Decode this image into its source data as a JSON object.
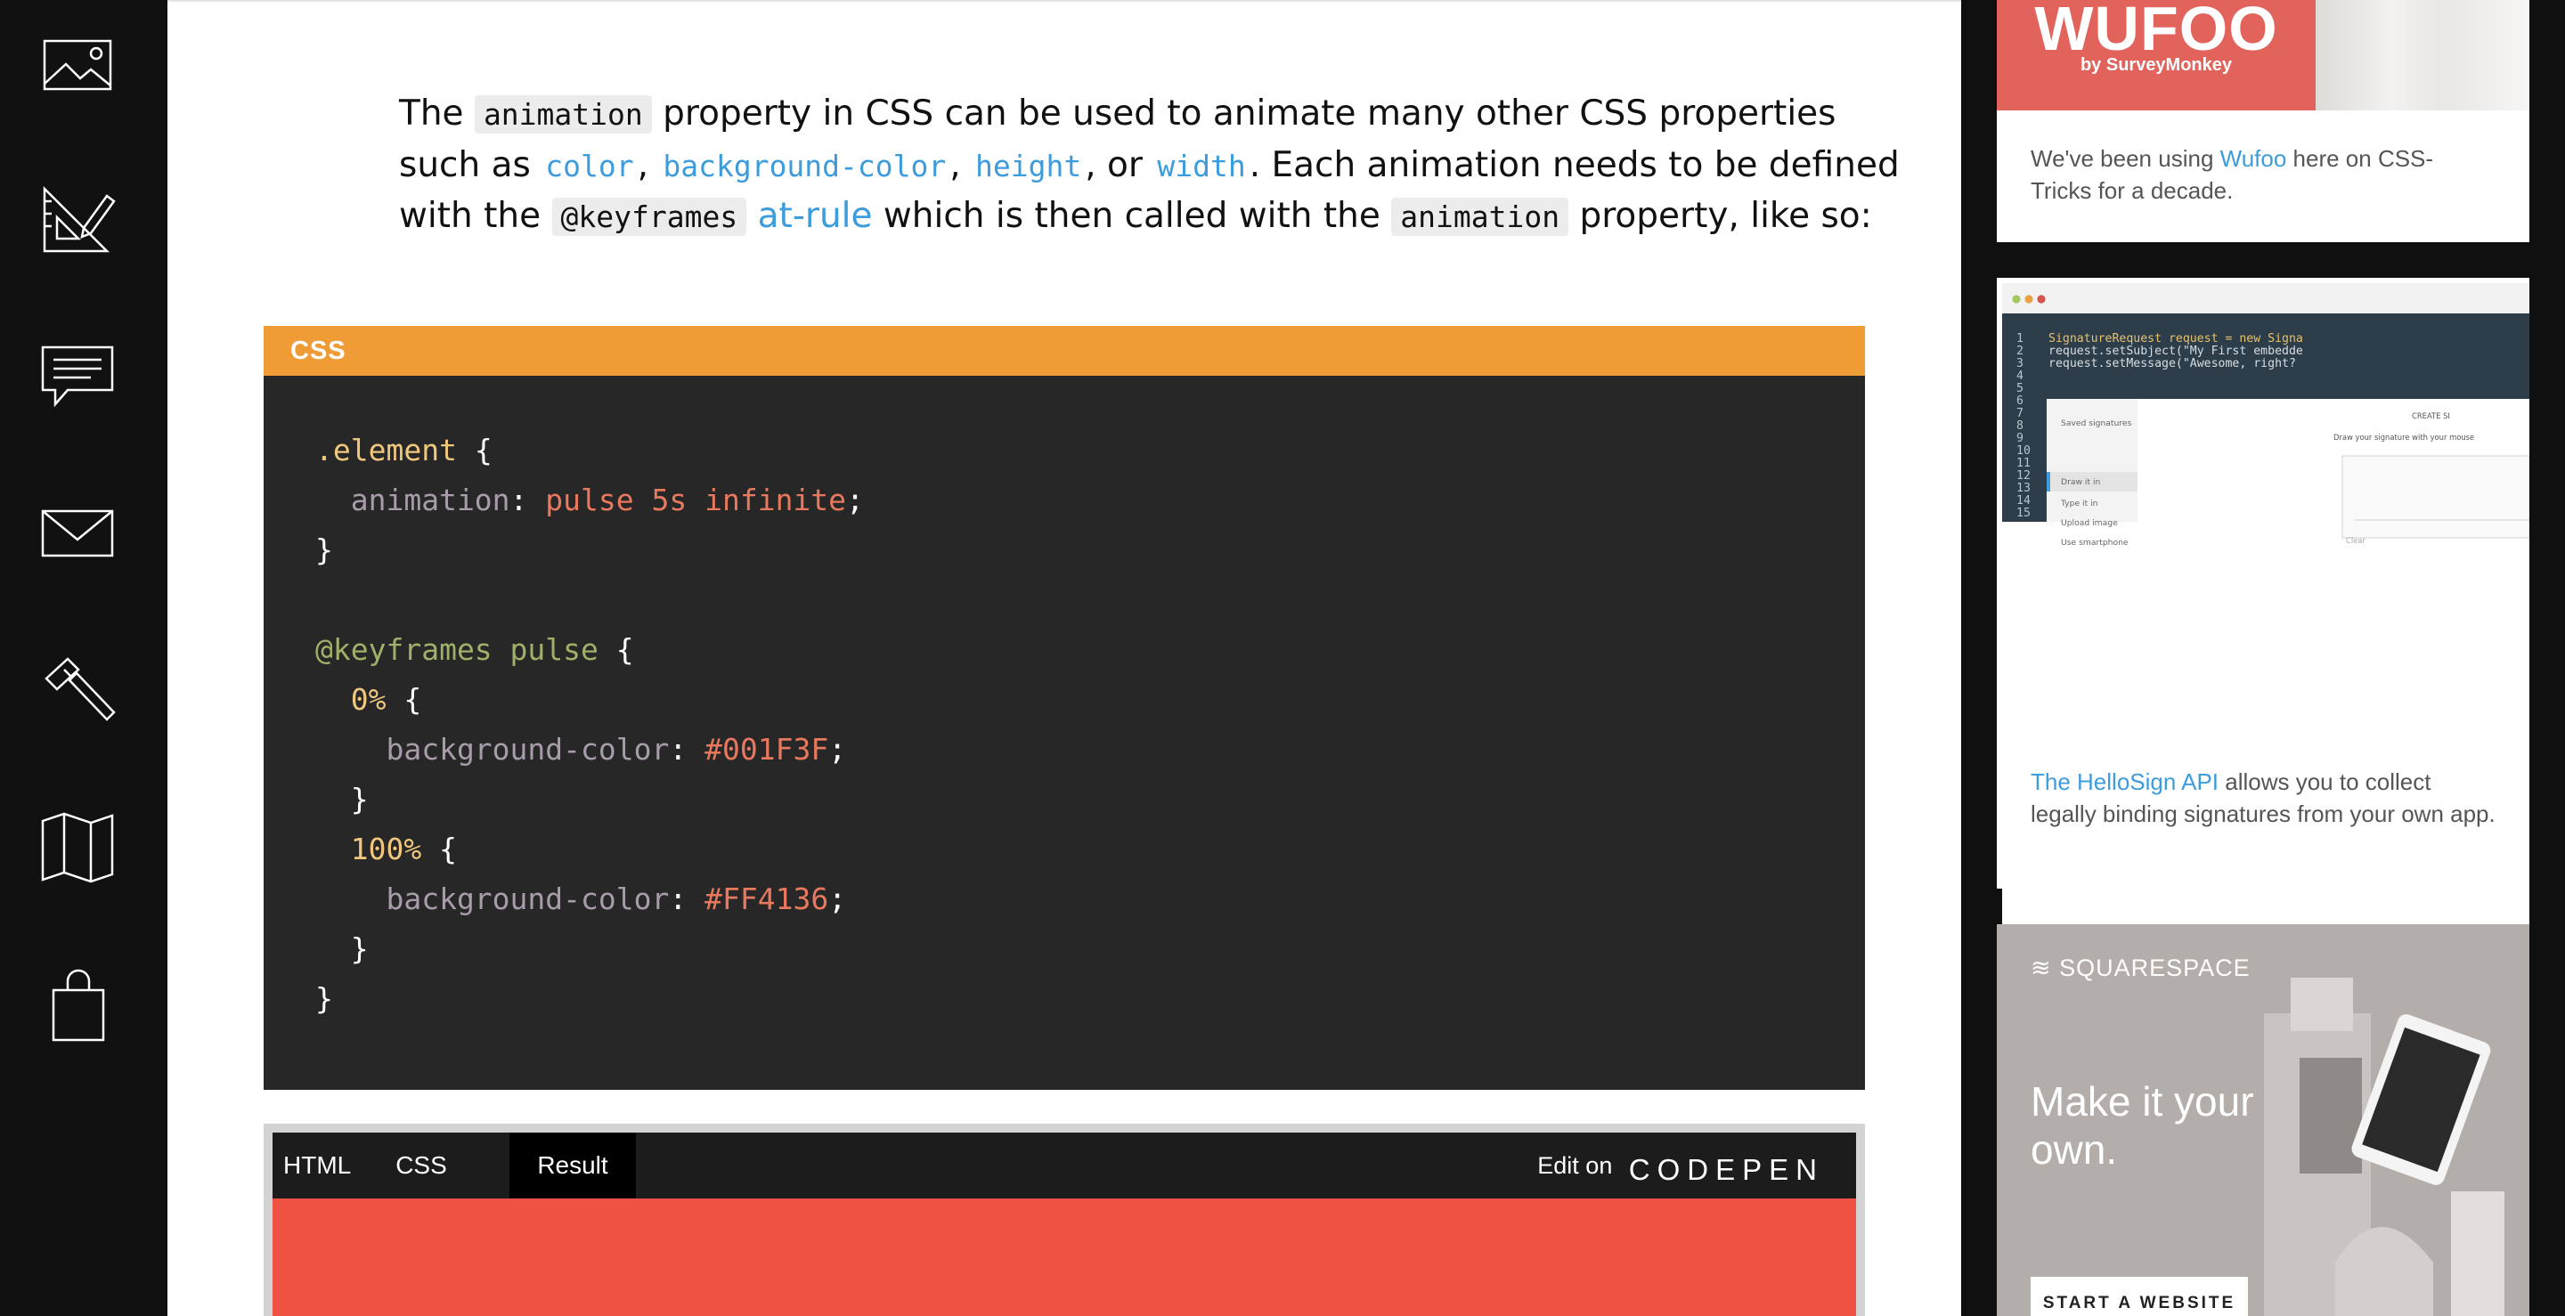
{
  "nav": {
    "items": [
      {
        "name": "images-icon"
      },
      {
        "name": "design-tools-icon"
      },
      {
        "name": "comments-icon"
      },
      {
        "name": "mail-icon"
      },
      {
        "name": "hammer-icon"
      },
      {
        "name": "map-icon"
      },
      {
        "name": "shopping-bag-icon"
      }
    ]
  },
  "article": {
    "intro": {
      "t1": "The ",
      "c1": "animation",
      "t2": " property in CSS can be used to animate many other CSS properties such as ",
      "l1": "color",
      "t3": ", ",
      "l2": "background-color",
      "t4": ", ",
      "l3": "height",
      "t5": ", or ",
      "l4": "width",
      "t6": ". Each animation needs to be defined with the ",
      "c2": "@keyframes",
      "t7": " ",
      "l5": "at-rule",
      "t8": " which is then called with the ",
      "c3": "animation",
      "t9": " property, like so:"
    },
    "code_block": {
      "language": "CSS",
      "lines": [
        {
          "tokens": [
            {
              "t": ".element",
              "c": "k-sel"
            },
            {
              "t": " {",
              "c": "k-pun"
            }
          ]
        },
        {
          "tokens": [
            {
              "t": "  animation",
              "c": "k-prop"
            },
            {
              "t": ": ",
              "c": "k-pun"
            },
            {
              "t": "pulse 5s infinite",
              "c": "k-val"
            },
            {
              "t": ";",
              "c": "k-pun"
            }
          ]
        },
        {
          "tokens": [
            {
              "t": "}",
              "c": "k-pun"
            }
          ]
        },
        {
          "tokens": []
        },
        {
          "tokens": [
            {
              "t": "@keyframes pulse",
              "c": "k-at"
            },
            {
              "t": " {",
              "c": "k-pun"
            }
          ]
        },
        {
          "tokens": [
            {
              "t": "  0%",
              "c": "k-pct"
            },
            {
              "t": " {",
              "c": "k-pun"
            }
          ]
        },
        {
          "tokens": [
            {
              "t": "    background-color",
              "c": "k-prop"
            },
            {
              "t": ": ",
              "c": "k-pun"
            },
            {
              "t": "#001F3F",
              "c": "k-val"
            },
            {
              "t": ";",
              "c": "k-pun"
            }
          ]
        },
        {
          "tokens": [
            {
              "t": "  }",
              "c": "k-pun"
            }
          ]
        },
        {
          "tokens": [
            {
              "t": "  100%",
              "c": "k-pct"
            },
            {
              "t": " {",
              "c": "k-pun"
            }
          ]
        },
        {
          "tokens": [
            {
              "t": "    background-color",
              "c": "k-prop"
            },
            {
              "t": ": ",
              "c": "k-pun"
            },
            {
              "t": "#FF4136",
              "c": "k-val"
            },
            {
              "t": ";",
              "c": "k-pun"
            }
          ]
        },
        {
          "tokens": [
            {
              "t": "  }",
              "c": "k-pun"
            }
          ]
        },
        {
          "tokens": [
            {
              "t": "}",
              "c": "k-pun"
            }
          ]
        }
      ]
    },
    "codepen": {
      "tabs": [
        "HTML",
        "CSS",
        "Result"
      ],
      "active_tab": "Result",
      "edit_label": "Edit on",
      "brand": "CODEPEN",
      "result_color": "#ef5242"
    }
  },
  "sidebar": {
    "wufoo": {
      "logo": "WUFOO",
      "byline": "by SurveyMonkey",
      "text_before": "We've been using ",
      "link": "Wufoo",
      "text_after": " here on CSS-Tricks for a decade."
    },
    "hellosign": {
      "code_lines": [
        {
          "num": "1",
          "text": "SignatureRequest request = new Signa"
        },
        {
          "num": "2",
          "text": "request.setSubject(\"My First embedde"
        },
        {
          "num": "3",
          "text": "request.setMessage(\"Awesome, right?"
        },
        {
          "num": "4",
          "text": ""
        },
        {
          "num": "5",
          "text": ""
        },
        {
          "num": "6",
          "text": ""
        },
        {
          "num": "7",
          "text": ""
        },
        {
          "num": "8",
          "text": ""
        },
        {
          "num": "9",
          "text": ""
        },
        {
          "num": "10",
          "text": ""
        },
        {
          "num": "11",
          "text": ""
        },
        {
          "num": "12",
          "text": ""
        },
        {
          "num": "13",
          "text": ""
        },
        {
          "num": "14",
          "text": ""
        },
        {
          "num": "15",
          "text": ""
        }
      ],
      "menu": [
        "Saved signatures",
        "Draw it in",
        "Type it in",
        "Upload image",
        "Use smartphone"
      ],
      "panel_title": "CREATE SI",
      "panel_hint": "Draw your signature with your mouse",
      "clear_label": "Clear",
      "link": "The HelloSign API",
      "text_after": " allows you to collect legally binding signatures from your own app."
    },
    "squarespace": {
      "logo": "SQUARESPACE",
      "headline": "Make it your own.",
      "button": "START A WEBSITE"
    }
  }
}
